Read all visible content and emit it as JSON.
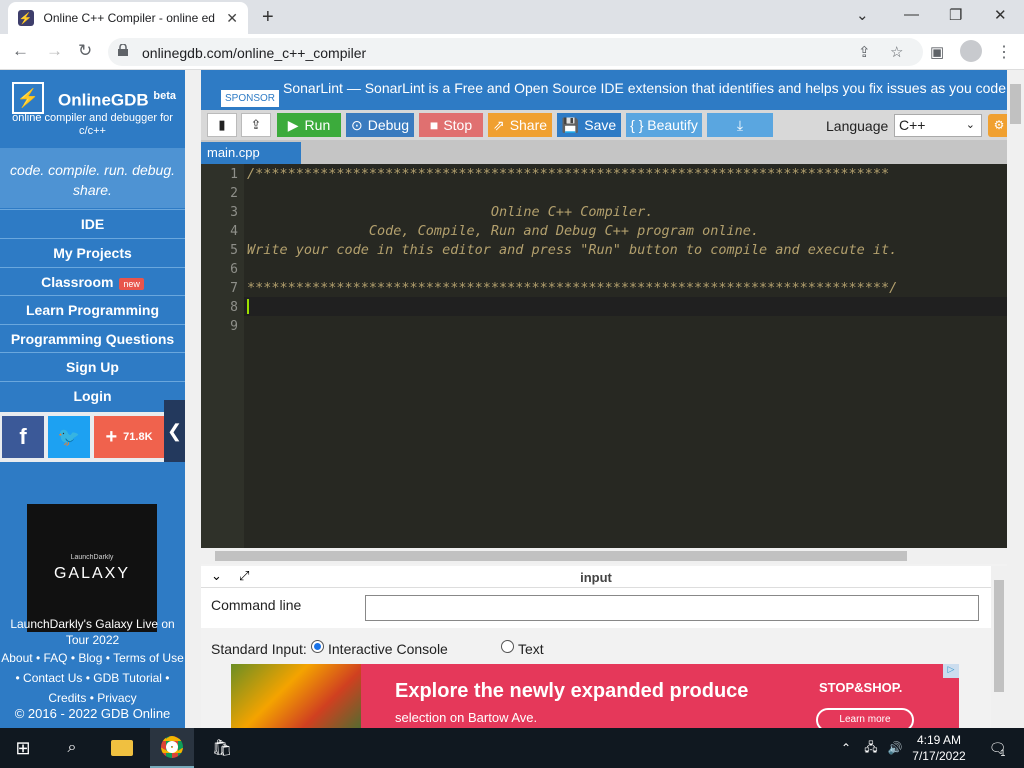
{
  "browser": {
    "tab_title": "Online C++ Compiler - online ed",
    "url": "onlinegdb.com/online_c++_compiler"
  },
  "sidebar": {
    "brand": "OnlineGDB",
    "brand_sup": "beta",
    "brand_sub": "online compiler and debugger for c/c++",
    "tagline": "code. compile. run. debug. share.",
    "nav": [
      {
        "label": "IDE"
      },
      {
        "label": "My Projects"
      },
      {
        "label": "Classroom",
        "badge": "new"
      },
      {
        "label": "Learn Programming"
      },
      {
        "label": "Programming Questions"
      },
      {
        "label": "Sign Up"
      },
      {
        "label": "Login"
      }
    ],
    "share_count": "71.8K",
    "ad": {
      "small": "LaunchDarkly",
      "big": "GALAXY",
      "caption": "LaunchDarkly's Galaxy Live on Tour 2022"
    },
    "footer_links": [
      "About",
      "FAQ",
      "Blog",
      "Terms of Use",
      "Contact Us",
      "GDB Tutorial",
      "Credits",
      "Privacy"
    ],
    "copyright": "© 2016 - 2022 GDB Online"
  },
  "sponsor": {
    "badge": "SPONSOR",
    "text": "SonarLint — SonarLint is a Free and Open Source IDE extension that identifies and helps you fix issues as you code."
  },
  "toolbar": {
    "run": "Run",
    "debug": "Debug",
    "stop": "Stop",
    "share": "Share",
    "save": "Save",
    "beautify": "{ } Beautify",
    "language_label": "Language",
    "language_value": "C++"
  },
  "file_tab": "main.cpp",
  "editor": {
    "lines": [
      "/******************************************************************************",
      "",
      "                              Online C++ Compiler.",
      "               Code, Compile, Run and Debug C++ program online.",
      "Write your code in this editor and press \"Run\" button to compile and execute it.",
      "",
      "*******************************************************************************/",
      "",
      ""
    ],
    "line_numbers": [
      "1",
      "2",
      "3",
      "4",
      "5",
      "6",
      "7",
      "8",
      "9"
    ]
  },
  "input_panel": {
    "title": "input",
    "command_line_label": "Command line arguments:",
    "stdin_label": "Standard Input:",
    "option_interactive": "Interactive Console",
    "option_text": "Text",
    "selected": "Interactive Console"
  },
  "ad_banner": {
    "headline": "Explore the newly expanded produce",
    "sub": "selection on Bartow Ave.",
    "brand": "STOP&SHOP.",
    "cta": "Learn more"
  },
  "taskbar": {
    "time": "4:19 AM",
    "date": "7/17/2022",
    "notification_count": "1"
  },
  "colors": {
    "brand_blue": "#2e7bc5",
    "run_green": "#3cab3c",
    "debug_blue": "#3a7bbf",
    "stop_red": "#e07070",
    "share_orange": "#f0a030",
    "editor_bg": "#272822",
    "comment": "#b3a06d"
  }
}
